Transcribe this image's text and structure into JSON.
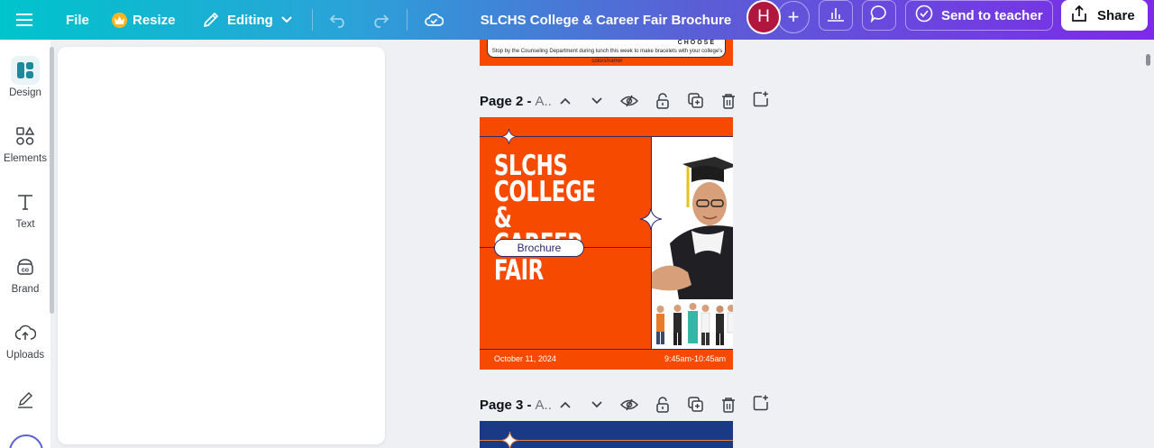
{
  "topbar": {
    "file_label": "File",
    "resize_label": "Resize",
    "editing_label": "Editing",
    "title": "SLCHS College & Career Fair Brochure",
    "avatar_initial": "H",
    "send_label": "Send to teacher",
    "share_label": "Share"
  },
  "rail": {
    "items": [
      {
        "label": "Design"
      },
      {
        "label": "Elements"
      },
      {
        "label": "Text"
      },
      {
        "label": "Brand"
      },
      {
        "label": "Uploads"
      }
    ]
  },
  "page1": {
    "strip_text": "Stop by the Counseling Department during lunch this week to make bracelets with your college's colors/name!",
    "clip_text": "CHOOSE"
  },
  "pages": [
    {
      "title": "Page 2 -",
      "name": "A.."
    },
    {
      "title": "Page 3 -",
      "name": "A.."
    }
  ],
  "page2": {
    "title_lines": [
      "SLCHS",
      "COLLEGE &",
      "CAREER FAIR"
    ],
    "pill": "Brochure",
    "date": "October 11, 2024",
    "time": "9:45am-10:45am"
  },
  "colors": {
    "brand_orange": "#f64a00",
    "navy": "#2d2a6e",
    "avatar": "#b0163e"
  }
}
